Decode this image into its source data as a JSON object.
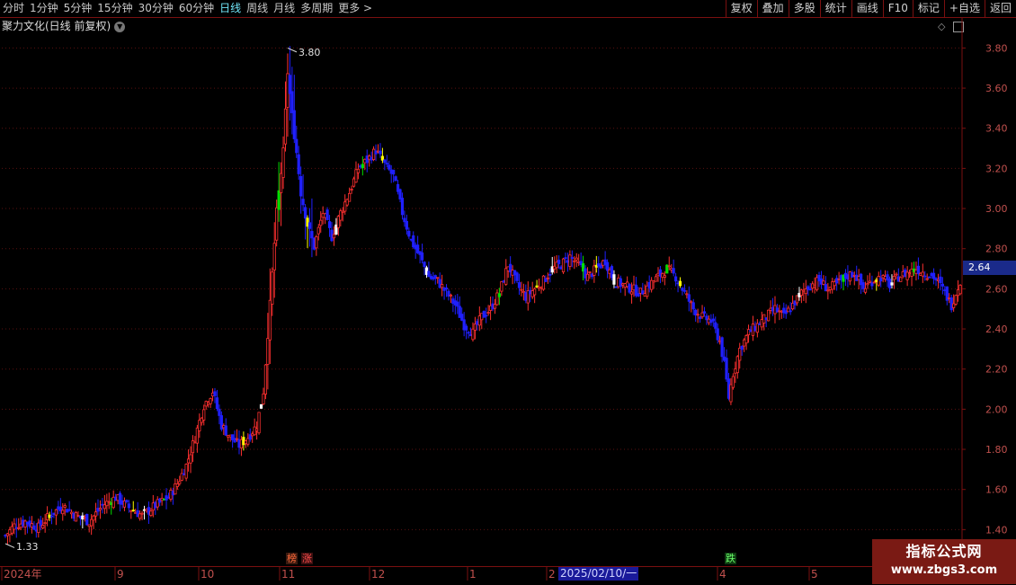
{
  "toolbar": {
    "periods": [
      "分时",
      "1分钟",
      "5分钟",
      "15分钟",
      "30分钟",
      "60分钟",
      "日线",
      "周线",
      "月线",
      "多周期",
      "更多 >"
    ],
    "active_period": "日线",
    "actions": [
      "复权",
      "叠加",
      "多股",
      "统计",
      "画线",
      "F10",
      "标记",
      "+自选",
      "返回"
    ]
  },
  "header": {
    "title": "聚力文化(日线 前复权)",
    "toggle_icon": "chevron-down-icon",
    "right_icons": [
      "diamond-icon",
      "panel-toggle-icon"
    ]
  },
  "chart_data": {
    "type": "candlestick",
    "ylim": [
      1.33,
      3.86
    ],
    "y_ticks": [
      "3.80",
      "3.60",
      "3.40",
      "3.20",
      "3.00",
      "2.80",
      "2.60",
      "2.40",
      "2.20",
      "2.00",
      "1.80",
      "1.60",
      "1.40"
    ],
    "x_tick_labels": [
      "2024年",
      "9",
      "10",
      "11",
      "12",
      "1",
      "2",
      "4",
      "5"
    ],
    "high_label": "3.80",
    "low_label": "1.33",
    "last_price": "2.64",
    "cursor_date": "2025/02/10/一",
    "flags": [
      "榜",
      "涨",
      "跌"
    ],
    "colors": {
      "up": "#ff3030",
      "down": "#2020ff",
      "highlight_yellow": "#ffff00",
      "highlight_white": "#ffffff",
      "highlight_green": "#00dd00",
      "axis_red": "#c0504d",
      "grid": "#5a1010"
    },
    "anchors": [
      [
        0,
        1.37
      ],
      [
        4,
        1.42
      ],
      [
        9,
        1.44
      ],
      [
        15,
        1.41
      ],
      [
        20,
        1.47
      ],
      [
        26,
        1.52
      ],
      [
        32,
        1.47
      ],
      [
        38,
        1.44
      ],
      [
        44,
        1.52
      ],
      [
        50,
        1.56
      ],
      [
        56,
        1.51
      ],
      [
        62,
        1.47
      ],
      [
        68,
        1.52
      ],
      [
        74,
        1.56
      ],
      [
        78,
        1.63
      ],
      [
        82,
        1.72
      ],
      [
        86,
        1.86
      ],
      [
        90,
        2.02
      ],
      [
        94,
        2.09
      ],
      [
        98,
        1.92
      ],
      [
        102,
        1.86
      ],
      [
        106,
        1.82
      ],
      [
        110,
        1.86
      ],
      [
        114,
        1.92
      ],
      [
        117,
        2.09
      ],
      [
        120,
        2.52
      ],
      [
        123,
        2.98
      ],
      [
        126,
        3.28
      ],
      [
        128,
        3.68
      ],
      [
        130,
        3.46
      ],
      [
        132,
        3.28
      ],
      [
        134,
        3.08
      ],
      [
        137,
        2.92
      ],
      [
        140,
        2.81
      ],
      [
        144,
        2.98
      ],
      [
        148,
        2.86
      ],
      [
        152,
        2.98
      ],
      [
        156,
        3.08
      ],
      [
        160,
        3.2
      ],
      [
        164,
        3.24
      ],
      [
        168,
        3.29
      ],
      [
        172,
        3.22
      ],
      [
        176,
        3.16
      ],
      [
        180,
        2.98
      ],
      [
        184,
        2.84
      ],
      [
        188,
        2.76
      ],
      [
        192,
        2.66
      ],
      [
        196,
        2.64
      ],
      [
        200,
        2.58
      ],
      [
        204,
        2.52
      ],
      [
        208,
        2.42
      ],
      [
        212,
        2.38
      ],
      [
        216,
        2.46
      ],
      [
        220,
        2.5
      ],
      [
        224,
        2.58
      ],
      [
        228,
        2.72
      ],
      [
        232,
        2.62
      ],
      [
        236,
        2.56
      ],
      [
        240,
        2.6
      ],
      [
        244,
        2.64
      ],
      [
        248,
        2.7
      ],
      [
        252,
        2.72
      ],
      [
        256,
        2.76
      ],
      [
        260,
        2.72
      ],
      [
        264,
        2.66
      ],
      [
        268,
        2.7
      ],
      [
        272,
        2.74
      ],
      [
        276,
        2.64
      ],
      [
        280,
        2.62
      ],
      [
        284,
        2.6
      ],
      [
        288,
        2.58
      ],
      [
        292,
        2.62
      ],
      [
        296,
        2.66
      ],
      [
        300,
        2.7
      ],
      [
        304,
        2.66
      ],
      [
        308,
        2.58
      ],
      [
        312,
        2.5
      ],
      [
        316,
        2.46
      ],
      [
        320,
        2.44
      ],
      [
        324,
        2.34
      ],
      [
        326,
        2.22
      ],
      [
        328,
        2.06
      ],
      [
        330,
        2.18
      ],
      [
        333,
        2.3
      ],
      [
        337,
        2.38
      ],
      [
        341,
        2.42
      ],
      [
        345,
        2.46
      ],
      [
        349,
        2.5
      ],
      [
        353,
        2.46
      ],
      [
        357,
        2.52
      ],
      [
        361,
        2.58
      ],
      [
        365,
        2.62
      ],
      [
        369,
        2.64
      ],
      [
        373,
        2.6
      ],
      [
        377,
        2.62
      ],
      [
        381,
        2.66
      ],
      [
        385,
        2.68
      ],
      [
        389,
        2.6
      ],
      [
        393,
        2.64
      ],
      [
        397,
        2.66
      ],
      [
        401,
        2.62
      ],
      [
        405,
        2.66
      ],
      [
        409,
        2.68
      ],
      [
        413,
        2.7
      ],
      [
        417,
        2.68
      ],
      [
        421,
        2.66
      ],
      [
        425,
        2.6
      ],
      [
        429,
        2.52
      ],
      [
        431,
        2.58
      ],
      [
        433,
        2.64
      ]
    ]
  }
}
